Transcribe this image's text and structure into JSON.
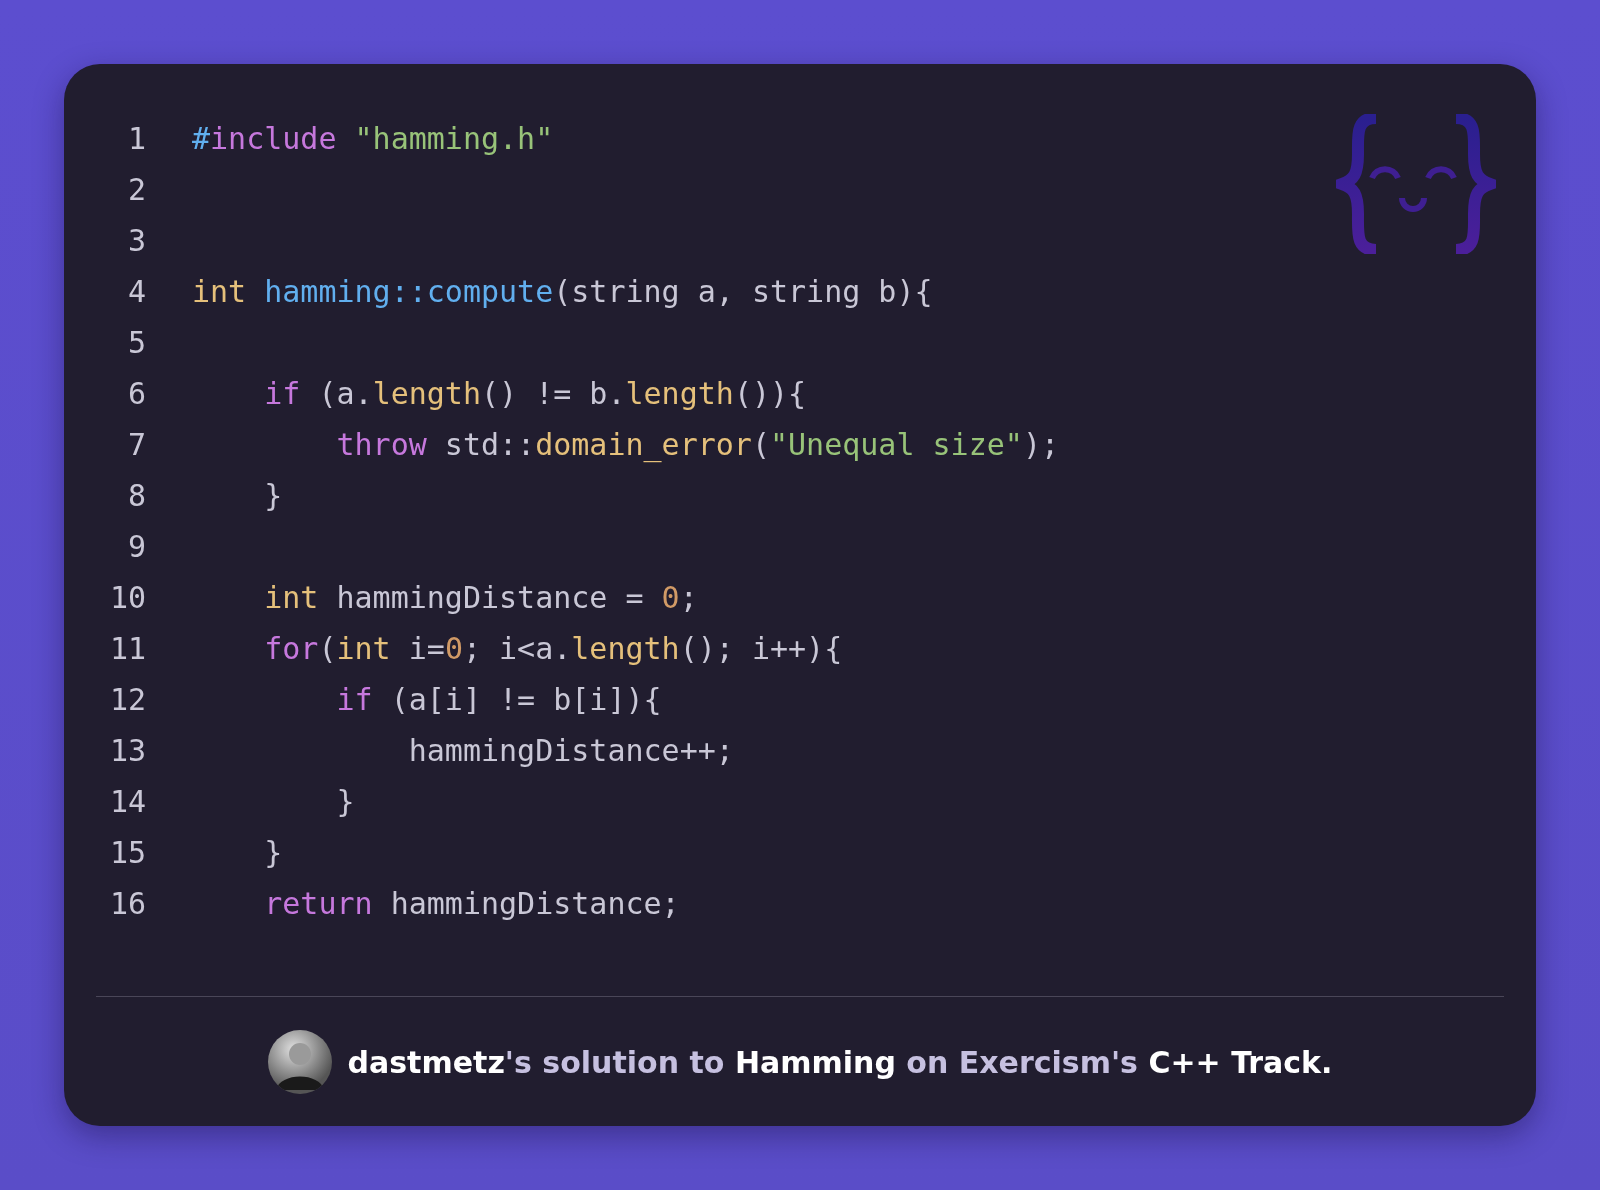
{
  "code": {
    "lines": [
      {
        "number": "1",
        "tokens": [
          {
            "text": "#",
            "kind": "macro"
          },
          {
            "text": "include",
            "kind": "keyword"
          },
          {
            "text": " \"hamming.h\"",
            "kind": "string"
          }
        ]
      },
      {
        "number": "2"
      },
      {
        "number": "3"
      },
      {
        "number": "4",
        "tokens": [
          {
            "text": "int ",
            "kind": "type"
          },
          {
            "text": "hamming::compute",
            "kind": "function"
          },
          {
            "text": "(string a, string b){",
            "kind": "plain"
          }
        ]
      },
      {
        "number": "5"
      },
      {
        "number": "6",
        "tokens": [
          {
            "text": "    if",
            "kind": "keyword"
          },
          {
            "text": " (a.",
            "kind": "plain"
          },
          {
            "text": "length",
            "kind": "method"
          },
          {
            "text": "() != b.",
            "kind": "plain"
          },
          {
            "text": "length",
            "kind": "method"
          },
          {
            "text": "()){",
            "kind": "plain"
          }
        ]
      },
      {
        "number": "7",
        "tokens": [
          {
            "text": "        throw",
            "kind": "keyword"
          },
          {
            "text": " std::",
            "kind": "plain"
          },
          {
            "text": "domain_error",
            "kind": "method"
          },
          {
            "text": "(",
            "kind": "plain"
          },
          {
            "text": "\"Unequal size\"",
            "kind": "string"
          },
          {
            "text": ");",
            "kind": "plain"
          }
        ]
      },
      {
        "number": "8",
        "tokens": [
          {
            "text": "    }",
            "kind": "plain"
          }
        ]
      },
      {
        "number": "9"
      },
      {
        "number": "10",
        "tokens": [
          {
            "text": "    int",
            "kind": "type"
          },
          {
            "text": " hammingDistance = ",
            "kind": "plain"
          },
          {
            "text": "0",
            "kind": "number"
          },
          {
            "text": ";",
            "kind": "plain"
          }
        ]
      },
      {
        "number": "11",
        "tokens": [
          {
            "text": "    for",
            "kind": "keyword"
          },
          {
            "text": "(",
            "kind": "plain"
          },
          {
            "text": "int",
            "kind": "type"
          },
          {
            "text": " i=",
            "kind": "plain"
          },
          {
            "text": "0",
            "kind": "number"
          },
          {
            "text": "; i<a.",
            "kind": "plain"
          },
          {
            "text": "length",
            "kind": "method"
          },
          {
            "text": "(); i++){",
            "kind": "plain"
          }
        ]
      },
      {
        "number": "12",
        "tokens": [
          {
            "text": "        if",
            "kind": "keyword"
          },
          {
            "text": " (a[i] != b[i]){",
            "kind": "plain"
          }
        ]
      },
      {
        "number": "13",
        "tokens": [
          {
            "text": "            hammingDistance++;",
            "kind": "plain"
          }
        ]
      },
      {
        "number": "14",
        "tokens": [
          {
            "text": "        }",
            "kind": "plain"
          }
        ]
      },
      {
        "number": "15",
        "tokens": [
          {
            "text": "    }",
            "kind": "plain"
          }
        ]
      },
      {
        "number": "16",
        "tokens": [
          {
            "text": "    return",
            "kind": "keyword"
          },
          {
            "text": " hammingDistance;",
            "kind": "plain"
          }
        ]
      }
    ]
  },
  "footer": {
    "caption": "**dastmetz**'s solution to **Hamming** on Exercism's **C++ Track.**"
  }
}
